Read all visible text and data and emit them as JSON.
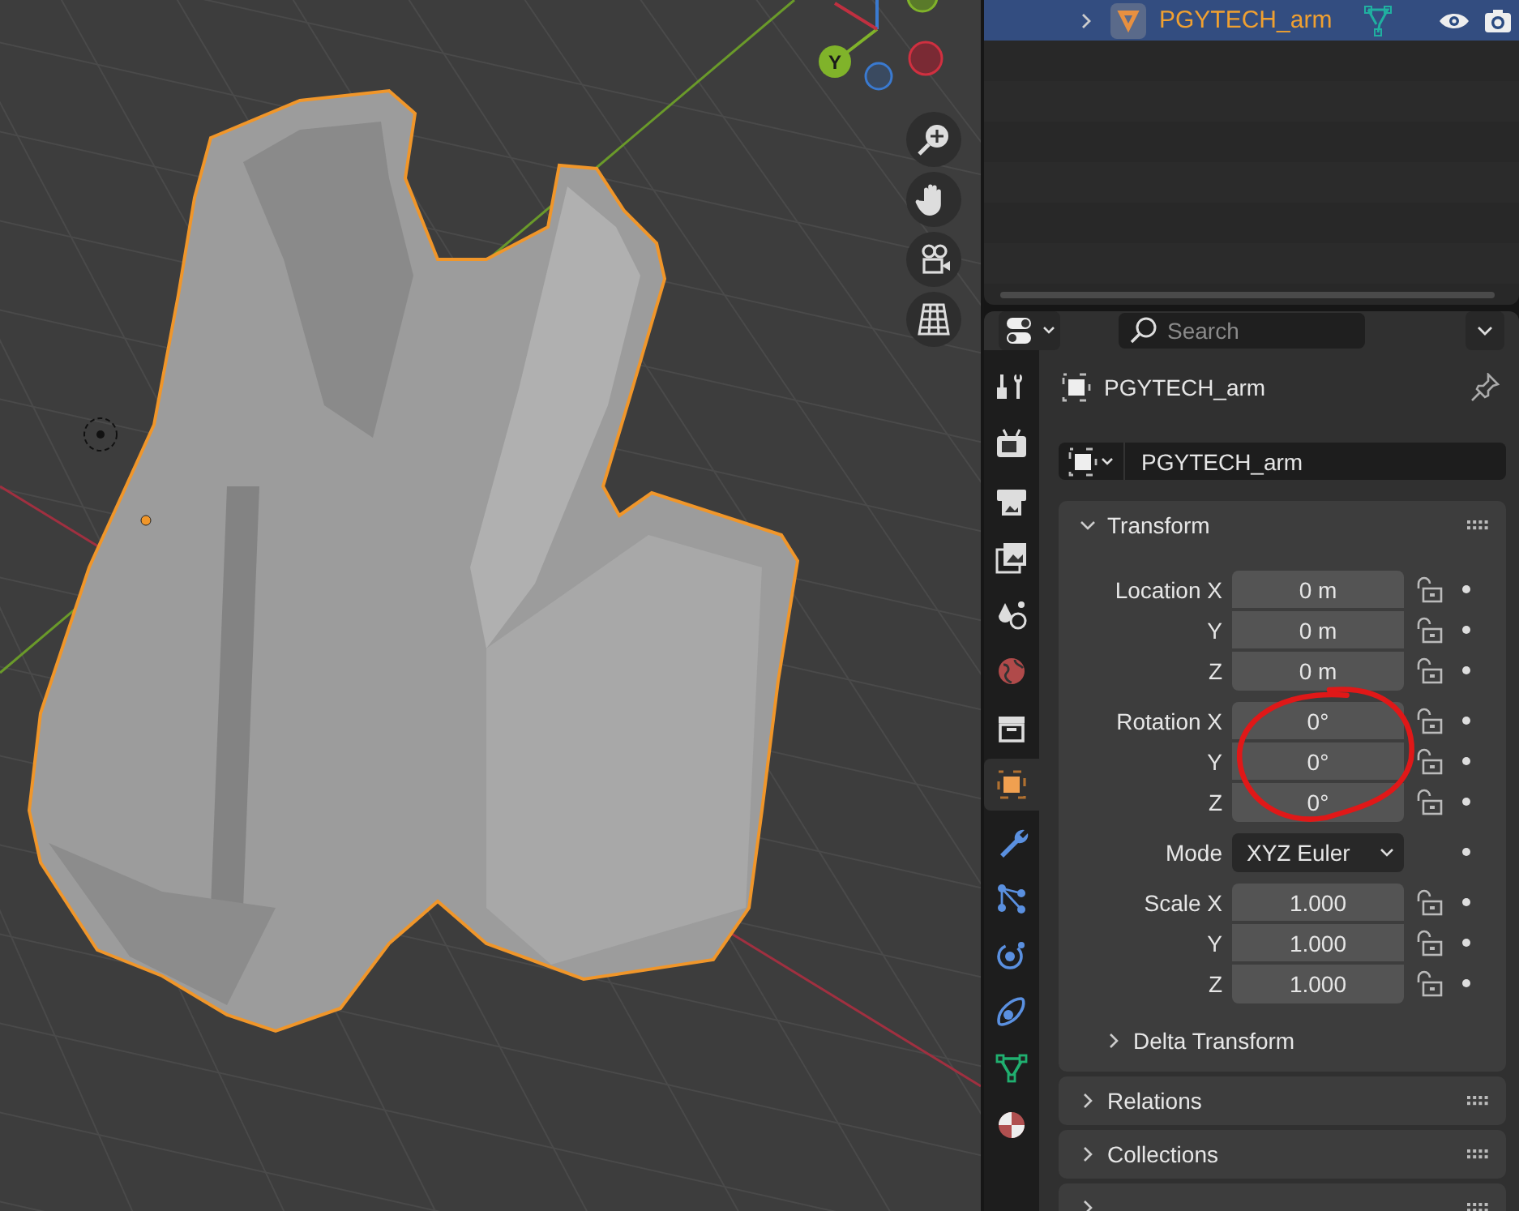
{
  "viewport": {
    "gizmo_label": "Y"
  },
  "outliner": {
    "rows": [
      {
        "name": "PGYTECH_arm",
        "selected": true,
        "expanded": false
      }
    ]
  },
  "properties": {
    "search": {
      "placeholder": "Search"
    },
    "tabs": [
      {
        "kind": "tool",
        "selected": false
      },
      {
        "kind": "render",
        "selected": false
      },
      {
        "kind": "output",
        "selected": false
      },
      {
        "kind": "view_layer",
        "selected": false
      },
      {
        "kind": "scene",
        "selected": false
      },
      {
        "kind": "world",
        "selected": false
      },
      {
        "kind": "collection",
        "selected": false
      },
      {
        "kind": "object",
        "selected": true
      },
      {
        "kind": "modifiers",
        "selected": false
      },
      {
        "kind": "particles",
        "selected": false
      },
      {
        "kind": "physics",
        "selected": false
      },
      {
        "kind": "constraints",
        "selected": false
      },
      {
        "kind": "data",
        "selected": false
      },
      {
        "kind": "material",
        "selected": false
      }
    ],
    "object_name": "PGYTECH_arm",
    "name_field": "PGYTECH_arm",
    "panels": [
      {
        "title": "Transform",
        "expanded": true,
        "groups": [
          {
            "rows": [
              {
                "kind": "number",
                "label": "Location X",
                "value": "0 m"
              },
              {
                "kind": "number",
                "label": "Y",
                "value": "0 m"
              },
              {
                "kind": "number",
                "label": "Z",
                "value": "0 m"
              }
            ]
          },
          {
            "rows": [
              {
                "kind": "number",
                "label": "Rotation X",
                "value": "0°"
              },
              {
                "kind": "number",
                "label": "Y",
                "value": "0°"
              },
              {
                "kind": "number",
                "label": "Z",
                "value": "0°"
              }
            ]
          },
          {
            "rows": [
              {
                "kind": "dropdown",
                "label": "Mode",
                "value": "XYZ Euler"
              }
            ]
          },
          {
            "rows": [
              {
                "kind": "number",
                "label": "Scale X",
                "value": "1.000"
              },
              {
                "kind": "number",
                "label": "Y",
                "value": "1.000"
              },
              {
                "kind": "number",
                "label": "Z",
                "value": "1.000"
              }
            ]
          }
        ],
        "subpanel": {
          "title": "Delta Transform",
          "expanded": false
        }
      },
      {
        "title": "Relations",
        "expanded": false
      },
      {
        "title": "Collections",
        "expanded": false
      },
      {
        "expanded": false
      }
    ]
  }
}
